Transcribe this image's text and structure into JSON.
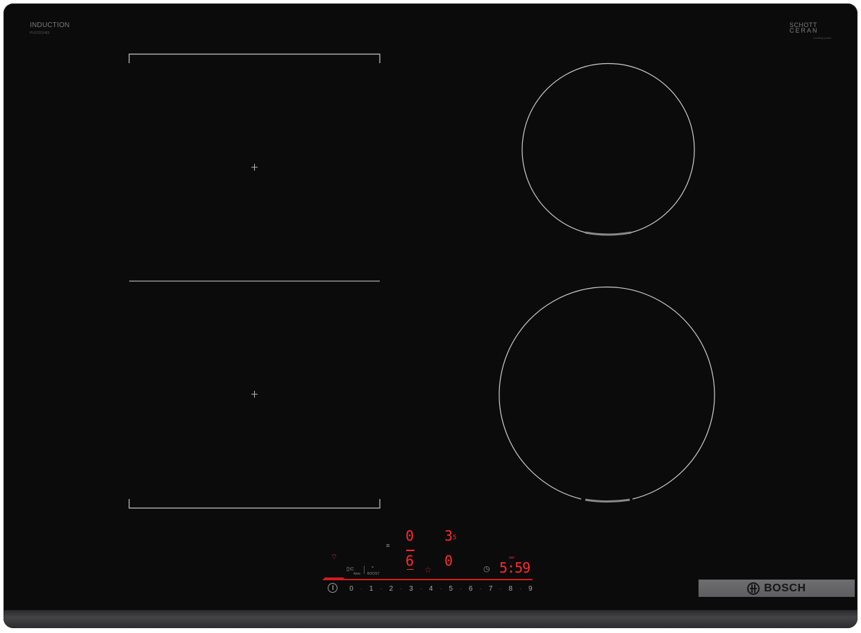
{
  "branding": {
    "induction_label": "INDUCTION",
    "model_code": "PVS7D1H83",
    "glass_brand_line1": "SCHOTT",
    "glass_brand_line2": "CERAN",
    "glass_brand_line3": "Cooktop panel",
    "manufacturer": "BOSCH"
  },
  "display": {
    "zone_top_left": "0",
    "zone_top_right": "3",
    "zone_top_right_sub": "5",
    "zone_bottom_left": "6",
    "zone_bottom_right": "0",
    "timer_label": "min",
    "timer_value": "5:59",
    "function_small_1": "4sec",
    "function_small_2": "BOOST"
  },
  "power_scale": {
    "steps": [
      "0",
      "1",
      "2",
      "3",
      "4",
      "5",
      "6",
      "7",
      "8",
      "9"
    ]
  },
  "colors": {
    "glass": "#0b0b0b",
    "indicator_red": "#ff2b2b",
    "zone_line": "#cfcfcf",
    "bosch_plate": "#666668"
  },
  "icons": {
    "wifi": "wifi-icon",
    "power": "power-icon",
    "timer": "clock-icon",
    "favorite": "star-icon"
  }
}
